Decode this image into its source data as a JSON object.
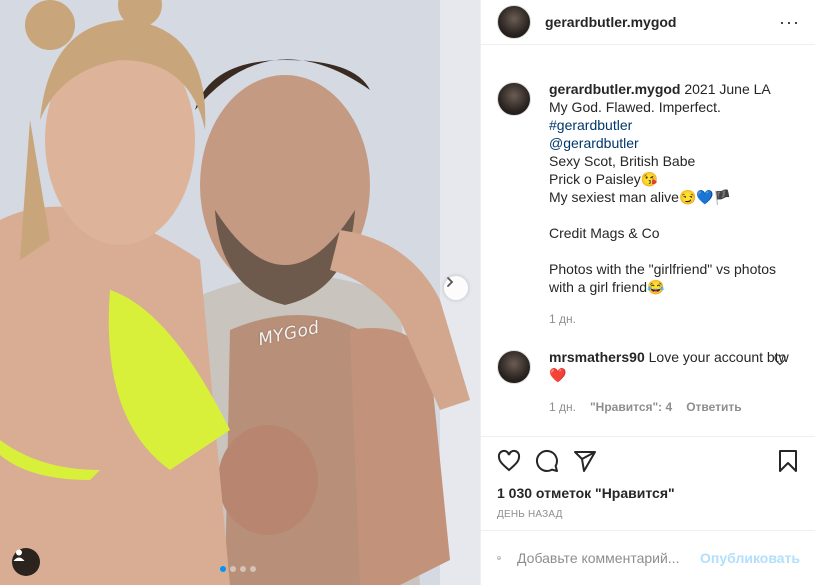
{
  "post": {
    "author": "gerardbutler.mygod",
    "watermark": "MYGod",
    "carousel": {
      "count": 4,
      "active_index": 0
    }
  },
  "header": {
    "username": "gerardbutler.mygod",
    "more_label": "···"
  },
  "caption": {
    "username": "gerardbutler.mygod",
    "line1": "2021 June LA",
    "line2": "My God. Flawed. Imperfect.",
    "hashtag": "#gerardbutler",
    "mention": "@gerardbutler",
    "line5": "Sexy Scot, British Babe",
    "line6": "Prick o Paisley",
    "line6_emoji": "😘",
    "line7": "My sexiest man alive",
    "line7_emoji": "😏💙🏴",
    "line8": "Credit Mags & Co",
    "line9": "Photos with the \"girlfriend\" vs photos with a girl friend",
    "line9_emoji": "😂",
    "time": "1 дн."
  },
  "comment": {
    "username": "mrsmathers90",
    "text": "Love your account btw",
    "emoji": "❤️",
    "time": "1 дн.",
    "likes": "\"Нравится\": 4",
    "reply": "Ответить"
  },
  "actions": {
    "like_icon": "heart-icon",
    "comment_icon": "comment-icon",
    "share_icon": "share-icon",
    "save_icon": "bookmark-icon"
  },
  "likes_text": "1 030 отметок \"Нравится\"",
  "date_text": "ДЕНЬ НАЗАД",
  "add_comment": {
    "placeholder": "Добавьте комментарий...",
    "publish_label": "Опубликовать"
  },
  "colors": {
    "accent": "#0095f6",
    "link": "#00376b",
    "publish_disabled": "#b2dffc"
  }
}
